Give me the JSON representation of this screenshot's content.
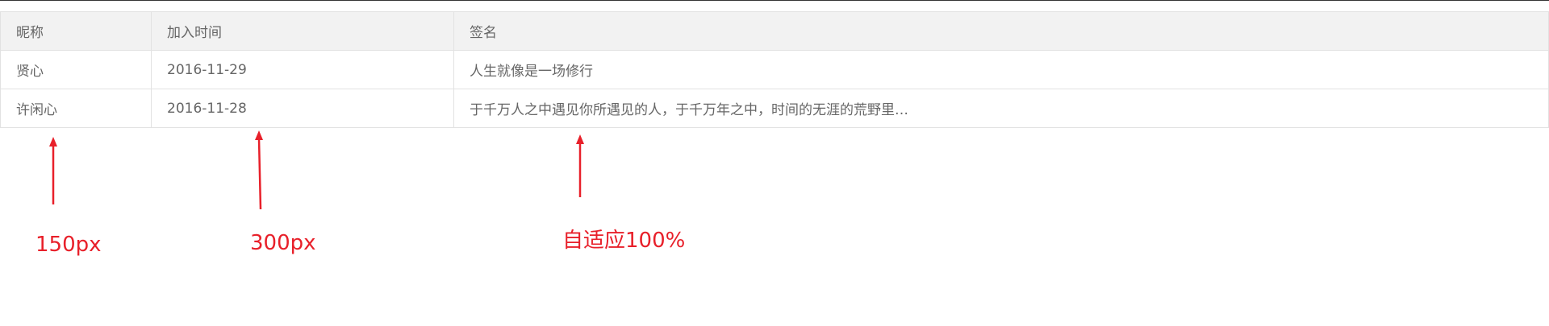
{
  "table": {
    "headers": [
      "昵称",
      "加入时间",
      "签名"
    ],
    "rows": [
      [
        "贤心",
        "2016-11-29",
        "人生就像是一场修行"
      ],
      [
        "许闲心",
        "2016-11-28",
        "于千万人之中遇见你所遇见的人，于千万年之中，时间的无涯的荒野里…"
      ]
    ]
  },
  "annotations": {
    "col1": "150px",
    "col2": "300px",
    "col3": "自适应100%"
  },
  "colors": {
    "annotation": "#e8202a",
    "header_bg": "#f2f2f2",
    "border": "#e2e2e2",
    "text": "#666666"
  }
}
